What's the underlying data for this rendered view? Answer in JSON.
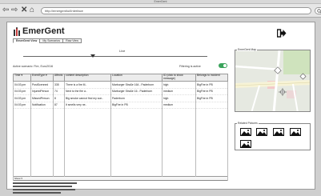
{
  "window": {
    "title": "EmerGent"
  },
  "browser": {
    "url": "http://emergent/ui/Interface"
  },
  "app": {
    "name": "EmerGent",
    "tabs": [
      {
        "label": "EmerGent View",
        "active": true
      },
      {
        "label": "My Scenarios",
        "active": false
      },
      {
        "label": "Raw View",
        "active": false
      }
    ]
  },
  "timeline": {
    "label": "Live",
    "position": 0.38
  },
  "scenario": {
    "active_label": "Active scenario: Fire, Euro2016"
  },
  "filter": {
    "label": "Filtering is active",
    "enabled": true
  },
  "table": {
    "columns": [
      "Time",
      "EventType",
      "Affects",
      "content description",
      "Location",
      "ID (click to show message)",
      "Belongs to incident"
    ],
    "rows": [
      [
        "04:03 pm",
        "PostScenned",
        "335",
        "There is a fire M..",
        "Marburger Straße 164 - Paderborn",
        "high",
        "BigFire in PB"
      ],
      [
        "04:03 pm",
        "InjuredPerson",
        "74",
        "Next to the fire a..",
        "Marburger Straße 16 - Paderborn",
        "medium",
        "BigFire in PB"
      ],
      [
        "04:03 pm",
        "MissedPerson",
        "8",
        "Big smoke cannot find my son..",
        "Paderborn",
        "high",
        "BigFire in PB"
      ],
      [
        "04:03 pm",
        "Notification",
        "87",
        "It smells very ne..",
        "BigFire in PB",
        "medium",
        ""
      ]
    ],
    "footer": "Show"
  },
  "map": {
    "label": "EmerGent Map"
  },
  "pictures": {
    "label": "Related Pictures",
    "count": 4
  },
  "colors": {
    "toggle_on": "#3aa35b",
    "map_road": "#f7f3d6",
    "map_park": "#cfe3bd",
    "map_block": "#f3c9c9"
  }
}
